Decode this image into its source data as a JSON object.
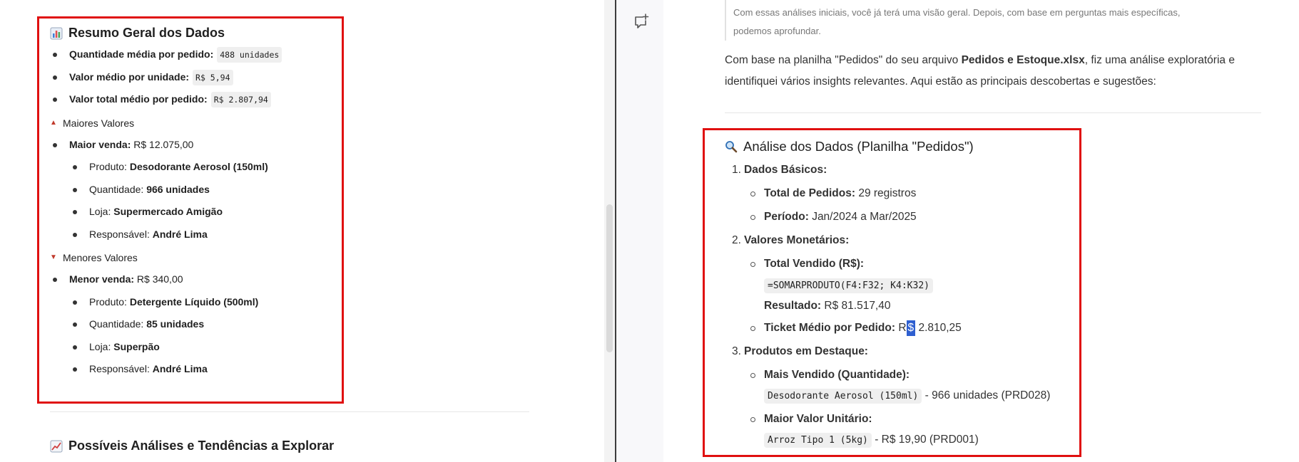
{
  "left": {
    "title": "Resumo Geral dos Dados",
    "stats": [
      {
        "label": "Quantidade média por pedido:",
        "value": "488 unidades"
      },
      {
        "label": "Valor médio por unidade:",
        "value": "R$ 5,94"
      },
      {
        "label": "Valor total médio por pedido:",
        "value": "R$ 2.807,94"
      }
    ],
    "max_heading": "Maiores Valores",
    "max_sale_label": "Maior venda:",
    "max_sale_value": "R$ 12.075,00",
    "max_details": [
      {
        "label": "Produto:",
        "value": "Desodorante Aerosol (150ml)"
      },
      {
        "label": "Quantidade:",
        "value": "966 unidades"
      },
      {
        "label": "Loja:",
        "value": "Supermercado Amigão"
      },
      {
        "label": "Responsável:",
        "value": "André Lima"
      }
    ],
    "min_heading": "Menores Valores",
    "min_sale_label": "Menor venda:",
    "min_sale_value": "R$ 340,00",
    "min_details": [
      {
        "label": "Produto:",
        "value": "Detergente Líquido (500ml)"
      },
      {
        "label": "Quantidade:",
        "value": "85 unidades"
      },
      {
        "label": "Loja:",
        "value": "Superpão"
      },
      {
        "label": "Responsável:",
        "value": "André Lima"
      }
    ],
    "next_title": "Possíveis Análises e Tendências a Explorar"
  },
  "right": {
    "quote": "Com essas análises iniciais, você já terá uma visão geral. Depois, com base em perguntas mais específicas, podemos aprofundar.",
    "intro_a": "Com base na planilha \"Pedidos\" do seu arquivo ",
    "intro_file": "Pedidos e Estoque.xlsx",
    "intro_b": ", fiz uma análise exploratória e identifiquei vários insights relevantes. Aqui estão as principais descobertas e sugestões:",
    "section_title": "Análise dos Dados (Planilha \"Pedidos\")",
    "s1": {
      "num": "1.",
      "title": "Dados Básicos:"
    },
    "s1_items": [
      {
        "label": "Total de Pedidos:",
        "value": "29 registros"
      },
      {
        "label": "Período:",
        "value": "Jan/2024 a Mar/2025"
      }
    ],
    "s2": {
      "num": "2.",
      "title": "Valores Monetários:"
    },
    "total_vendido_label": "Total Vendido (R$):",
    "formula": "=SOMARPRODUTO(F4:F32; K4:K32)",
    "resultado_label": "Resultado:",
    "resultado_value": "R$ 81.517,40",
    "ticket_label": "Ticket Médio por Pedido:",
    "ticket_pre": "R",
    "ticket_hl": "$",
    "ticket_post": " 2.810,25",
    "s3": {
      "num": "3.",
      "title": "Produtos em Destaque:"
    },
    "mais_vendido_label": "Mais Vendido (Quantidade):",
    "mais_vendido_code": "Desodorante Aerosol (150ml)",
    "mais_vendido_rest": " - 966 unidades (PRD028)",
    "maior_valor_label": "Maior Valor Unitário:",
    "maior_valor_code": "Arroz Tipo 1 (5kg)",
    "maior_valor_rest": " - R$ 19,90 (PRD001)"
  },
  "colors": {
    "highlight_box": "#e01010",
    "cursor_highlight": "#2e5fd0"
  },
  "icons": [
    "bar-chart-emoji-icon",
    "red-triangle-up-icon",
    "red-triangle-down-icon",
    "chart-increasing-emoji-icon",
    "magnifying-glass-emoji-icon",
    "new-chat-icon"
  ]
}
